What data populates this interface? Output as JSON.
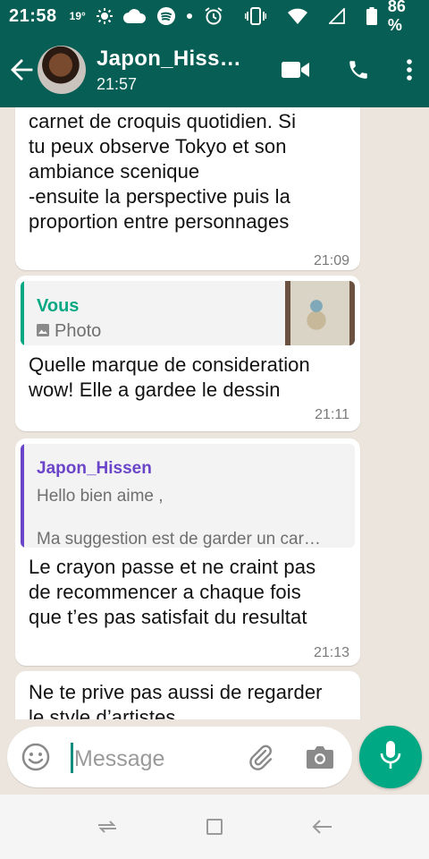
{
  "status_bar": {
    "time": "21:58",
    "temperature": "19°",
    "battery_percent": "86 %"
  },
  "header": {
    "contact_name": "Japon_Hiss…",
    "last_seen": "21:57"
  },
  "messages": [
    {
      "lines": [
        "carnet de croquis quotidien. Si",
        "tu peux observe Tokyo et son",
        "ambiance scenique",
        "-ensuite la perspective puis la",
        "proportion entre personnages"
      ],
      "time": "21:09"
    },
    {
      "quote": {
        "author": "Vous",
        "type": "Photo"
      },
      "lines": [
        "Quelle marque de consideration",
        "wow! Elle a gardee le dessin"
      ],
      "time": "21:11"
    },
    {
      "quote": {
        "author": "Japon_Hissen",
        "line1": "Hello bien aime ,",
        "line2": "Ma suggestion est de garder un car…"
      },
      "lines": [
        "Le crayon passe et ne craint pas",
        "de recommencer a chaque fois",
        "que t’es pas satisfait du resultat"
      ],
      "time": "21:13"
    },
    {
      "lines": [
        "Ne te prive pas aussi de regarder",
        "le style d’artistes"
      ]
    }
  ],
  "input": {
    "placeholder": "Message"
  },
  "colors": {
    "header": "#075e54",
    "accent_green": "#00a884",
    "quote_you": "#06a884",
    "quote_other": "#6b45c9",
    "chat_bg": "#ece5dd"
  },
  "icons": [
    "back-arrow-icon",
    "video-call-icon",
    "phone-icon",
    "more-vert-icon",
    "emoji-icon",
    "attach-icon",
    "camera-icon",
    "mic-icon",
    "photo-icon"
  ]
}
